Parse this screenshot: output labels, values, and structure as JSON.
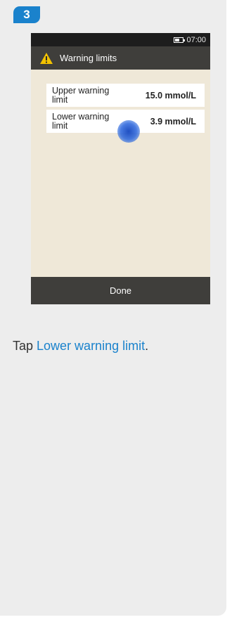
{
  "step_number": "3",
  "status_bar": {
    "time": "07:00"
  },
  "title_bar": {
    "title": "Warning limits"
  },
  "rows": [
    {
      "label": "Upper warning limit",
      "value": "15.0 mmol/L"
    },
    {
      "label": "Lower warning limit",
      "value": "3.9 mmol/L"
    }
  ],
  "footer": {
    "done_label": "Done"
  },
  "instruction": {
    "prefix": "Tap ",
    "link": "Lower warning limit",
    "suffix": "."
  },
  "colors": {
    "accent": "#1a82cc",
    "warning": "#f2c200",
    "screen_bg": "#efe8d8",
    "bar": "#3f3e3b"
  }
}
